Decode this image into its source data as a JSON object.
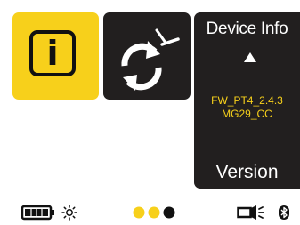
{
  "tiles": {
    "info": {
      "glyph": "i",
      "color": "#f7d01b"
    },
    "sync": {
      "color": "#221f1f"
    },
    "detail": {
      "title": "Device Info",
      "firmware": "FW_PT4_2.4.3",
      "model": "MG29_CC",
      "footer": "Version"
    }
  },
  "status_bar": {
    "battery_level": 1.0,
    "page_dots": {
      "count": 3,
      "active": 3,
      "inactive_color": "#f7d01b",
      "active_color": "#111111"
    }
  },
  "colors": {
    "accent": "#f7d01b",
    "dark": "#221f1f"
  }
}
